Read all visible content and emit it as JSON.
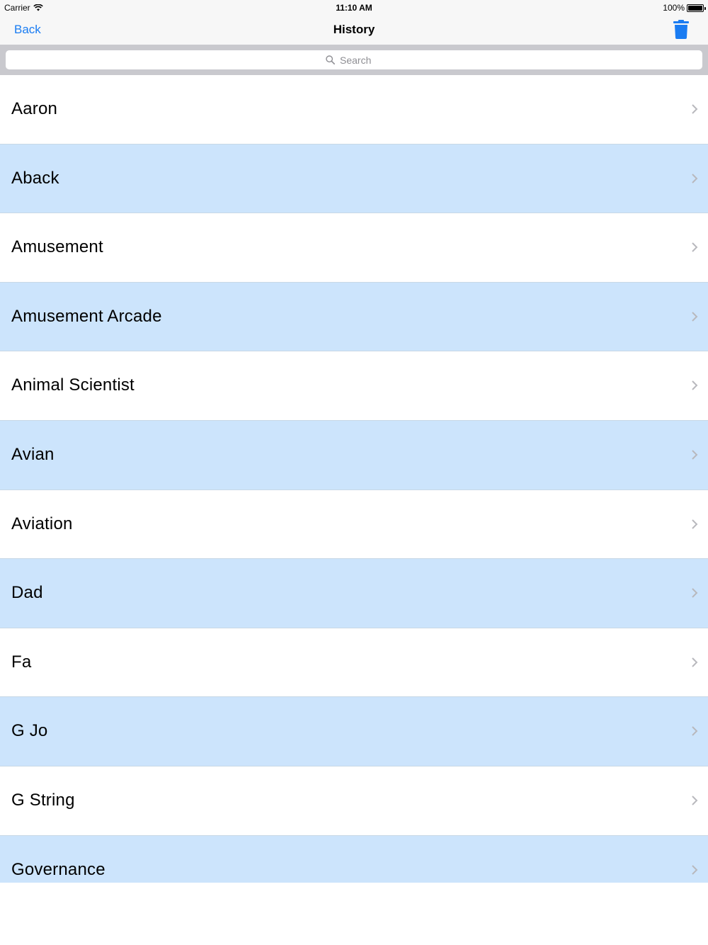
{
  "status_bar": {
    "carrier": "Carrier",
    "time": "11:10 AM",
    "battery": "100%",
    "battery_level": 1.0
  },
  "nav": {
    "back_label": "Back",
    "title": "History",
    "trash_icon": "trash-icon"
  },
  "search": {
    "placeholder": "Search",
    "icon": "search-icon"
  },
  "colors": {
    "accent": "#1a7cf2",
    "row_alt": "#cce4fc",
    "row": "#ffffff",
    "search_bg": "#c9c9ce"
  },
  "list": {
    "items": [
      {
        "label": "Aaron"
      },
      {
        "label": "Aback"
      },
      {
        "label": "Amusement"
      },
      {
        "label": "Amusement Arcade"
      },
      {
        "label": "Animal Scientist"
      },
      {
        "label": "Avian"
      },
      {
        "label": "Aviation"
      },
      {
        "label": "Dad"
      },
      {
        "label": "Fa"
      },
      {
        "label": "G Jo"
      },
      {
        "label": "G String"
      },
      {
        "label": "Governance"
      }
    ]
  }
}
